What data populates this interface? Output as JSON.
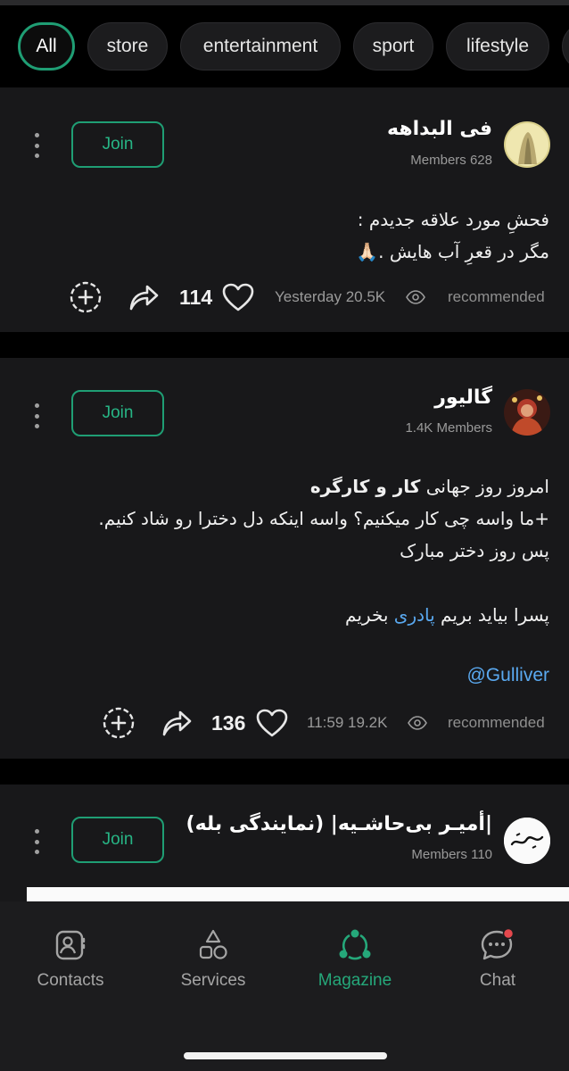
{
  "categories": [
    "All",
    "store",
    "entertainment",
    "sport",
    "lifestyle"
  ],
  "join_label": "Join",
  "posts": [
    {
      "channel": "فی البداهه",
      "members": "Members 628",
      "lines": [
        "فحشِ مورد علاقه جدیدم :",
        "مگر در قعرِ آب هایش .🙏🏻"
      ],
      "likes": "114",
      "meta": "Yesterday 20.5K",
      "tag": "recommended"
    },
    {
      "channel": "گالیور",
      "members": "1.4K Members",
      "line1_prefix": "امروز روز جهانی ",
      "line1_bold": "کار و کارگره",
      "line2": "+ما واسه چی کار میکنیم؟ واسه اینکه دل دخترا رو شاد کنیم.",
      "line3": "پس روز دختر مبارک",
      "line4_prefix": "پسرا بیاید بریم ",
      "line4_link": "پادری",
      "line4_suffix": " بخریم",
      "mention": "@Gulliver",
      "likes": "136",
      "meta": "11:59 19.2K",
      "tag": "recommended"
    },
    {
      "channel": "|أمیـر بی‌حاشـیه| (نمایندگی بله)",
      "members": "Members 110"
    }
  ],
  "nav": [
    {
      "label": "Contacts",
      "icon": "contacts-icon"
    },
    {
      "label": "Services",
      "icon": "services-icon"
    },
    {
      "label": "Magazine",
      "icon": "magazine-icon"
    },
    {
      "label": "Chat",
      "icon": "chat-icon"
    }
  ],
  "colors": {
    "accent": "#1f9e74",
    "link": "#5aa9f0",
    "card": "#18181a",
    "notification": "#e5484d"
  }
}
